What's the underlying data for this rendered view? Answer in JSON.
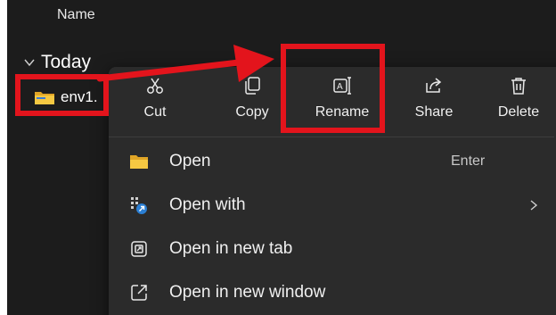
{
  "file_list": {
    "column_name": "Name",
    "group_label": "Today",
    "file_name": "env1."
  },
  "context_menu": {
    "toolbar": [
      {
        "label": "Cut",
        "icon": "scissors-icon"
      },
      {
        "label": "Copy",
        "icon": "copy-icon"
      },
      {
        "label": "Rename",
        "icon": "rename-icon"
      },
      {
        "label": "Share",
        "icon": "share-icon"
      },
      {
        "label": "Delete",
        "icon": "trash-icon"
      }
    ],
    "items": [
      {
        "label": "Open",
        "icon": "folder-icon",
        "shortcut": "Enter"
      },
      {
        "label": "Open with",
        "icon": "open-with-icon"
      },
      {
        "label": "Open in new tab",
        "icon": "new-tab-icon"
      },
      {
        "label": "Open in new window",
        "icon": "new-window-icon"
      }
    ]
  },
  "annotation": {
    "highlight_color": "#e3141c"
  }
}
